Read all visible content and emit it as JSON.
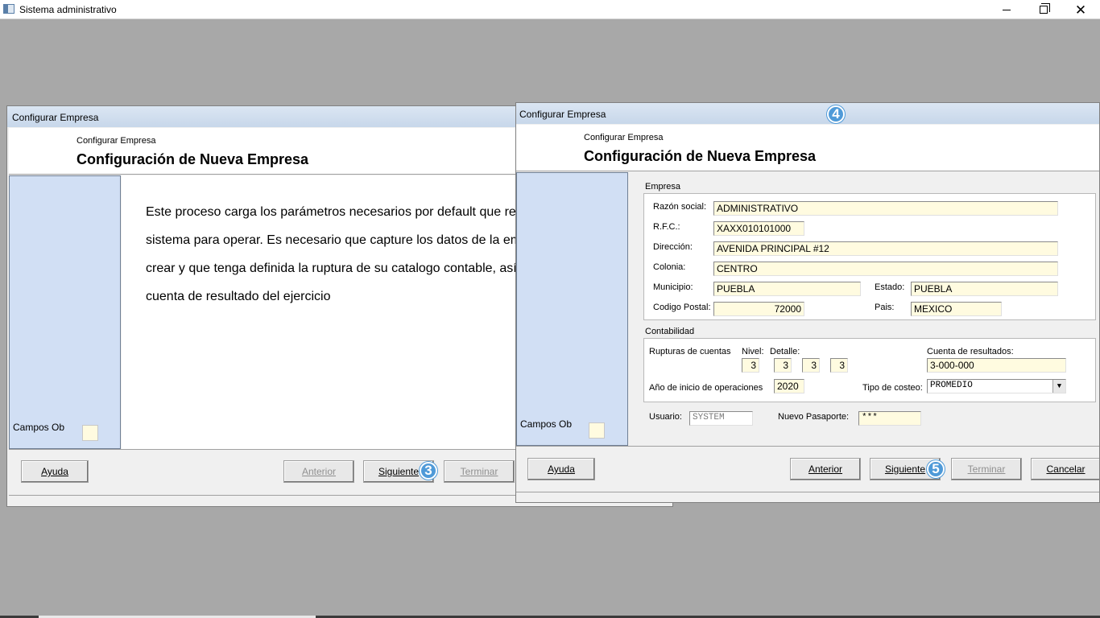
{
  "app": {
    "title": "Sistema administrativo"
  },
  "dialog_a": {
    "title": "Configurar Empresa",
    "header_small": "Configurar Empresa",
    "header_big": "Configuración de Nueva Empresa",
    "paragraph_lines": [
      "Este proceso carga los parámetros necesarios por default que req",
      "sistema para operar. Es necesario que capture los datos de la emp",
      "crear y que tenga definida la ruptura de su catalogo contable, así co",
      "cuenta de resultado del ejercicio"
    ],
    "required_label": "Campos Obligatorios",
    "buttons": {
      "ayuda": "Ayuda",
      "anterior": "Anterior",
      "siguiente": "Siguiente",
      "terminar": "Terminar"
    },
    "badge": "3"
  },
  "dialog_b": {
    "title": "Configurar Empresa",
    "title_badge": "4",
    "header_small": "Configurar Empresa",
    "header_big": "Configuración de Nueva Empresa",
    "required_label": "Campos Obligatorios",
    "empresa": {
      "group_label": "Empresa",
      "razon_social_label": "Razón social:",
      "razon_social": "ADMINISTRATIVO",
      "rfc_label": "R.F.C.:",
      "rfc": "XAXX010101000",
      "direccion_label": "Dirección:",
      "direccion": "AVENIDA PRINCIPAL #12",
      "colonia_label": "Colonia:",
      "colonia": "CENTRO",
      "municipio_label": "Municipio:",
      "municipio": "PUEBLA",
      "estado_label": "Estado:",
      "estado": "PUEBLA",
      "cp_label": "Codigo Postal:",
      "cp": "72000",
      "pais_label": "Pais:",
      "pais": "MEXICO"
    },
    "contabilidad": {
      "group_label": "Contabilidad",
      "rupturas_label": "Rupturas de cuentas",
      "nivel_label": "Nivel:",
      "nivel": "3",
      "detalle_label": "Detalle:",
      "detalle": [
        "3",
        "3",
        "3"
      ],
      "cuenta_label": "Cuenta de resultados:",
      "cuenta": "3-000-000",
      "anio_label": "Año de inicio de operaciones",
      "anio": "2020",
      "costeo_label": "Tipo de costeo:",
      "costeo": "PROMEDIO"
    },
    "usuario_label": "Usuario:",
    "usuario": "SYSTEM",
    "pasaporte_label": "Nuevo Pasaporte:",
    "pasaporte": "***",
    "buttons": {
      "ayuda": "Ayuda",
      "anterior": "Anterior",
      "siguiente": "Siguiente",
      "terminar": "Terminar",
      "cancelar": "Cancelar"
    },
    "badge": "5"
  }
}
